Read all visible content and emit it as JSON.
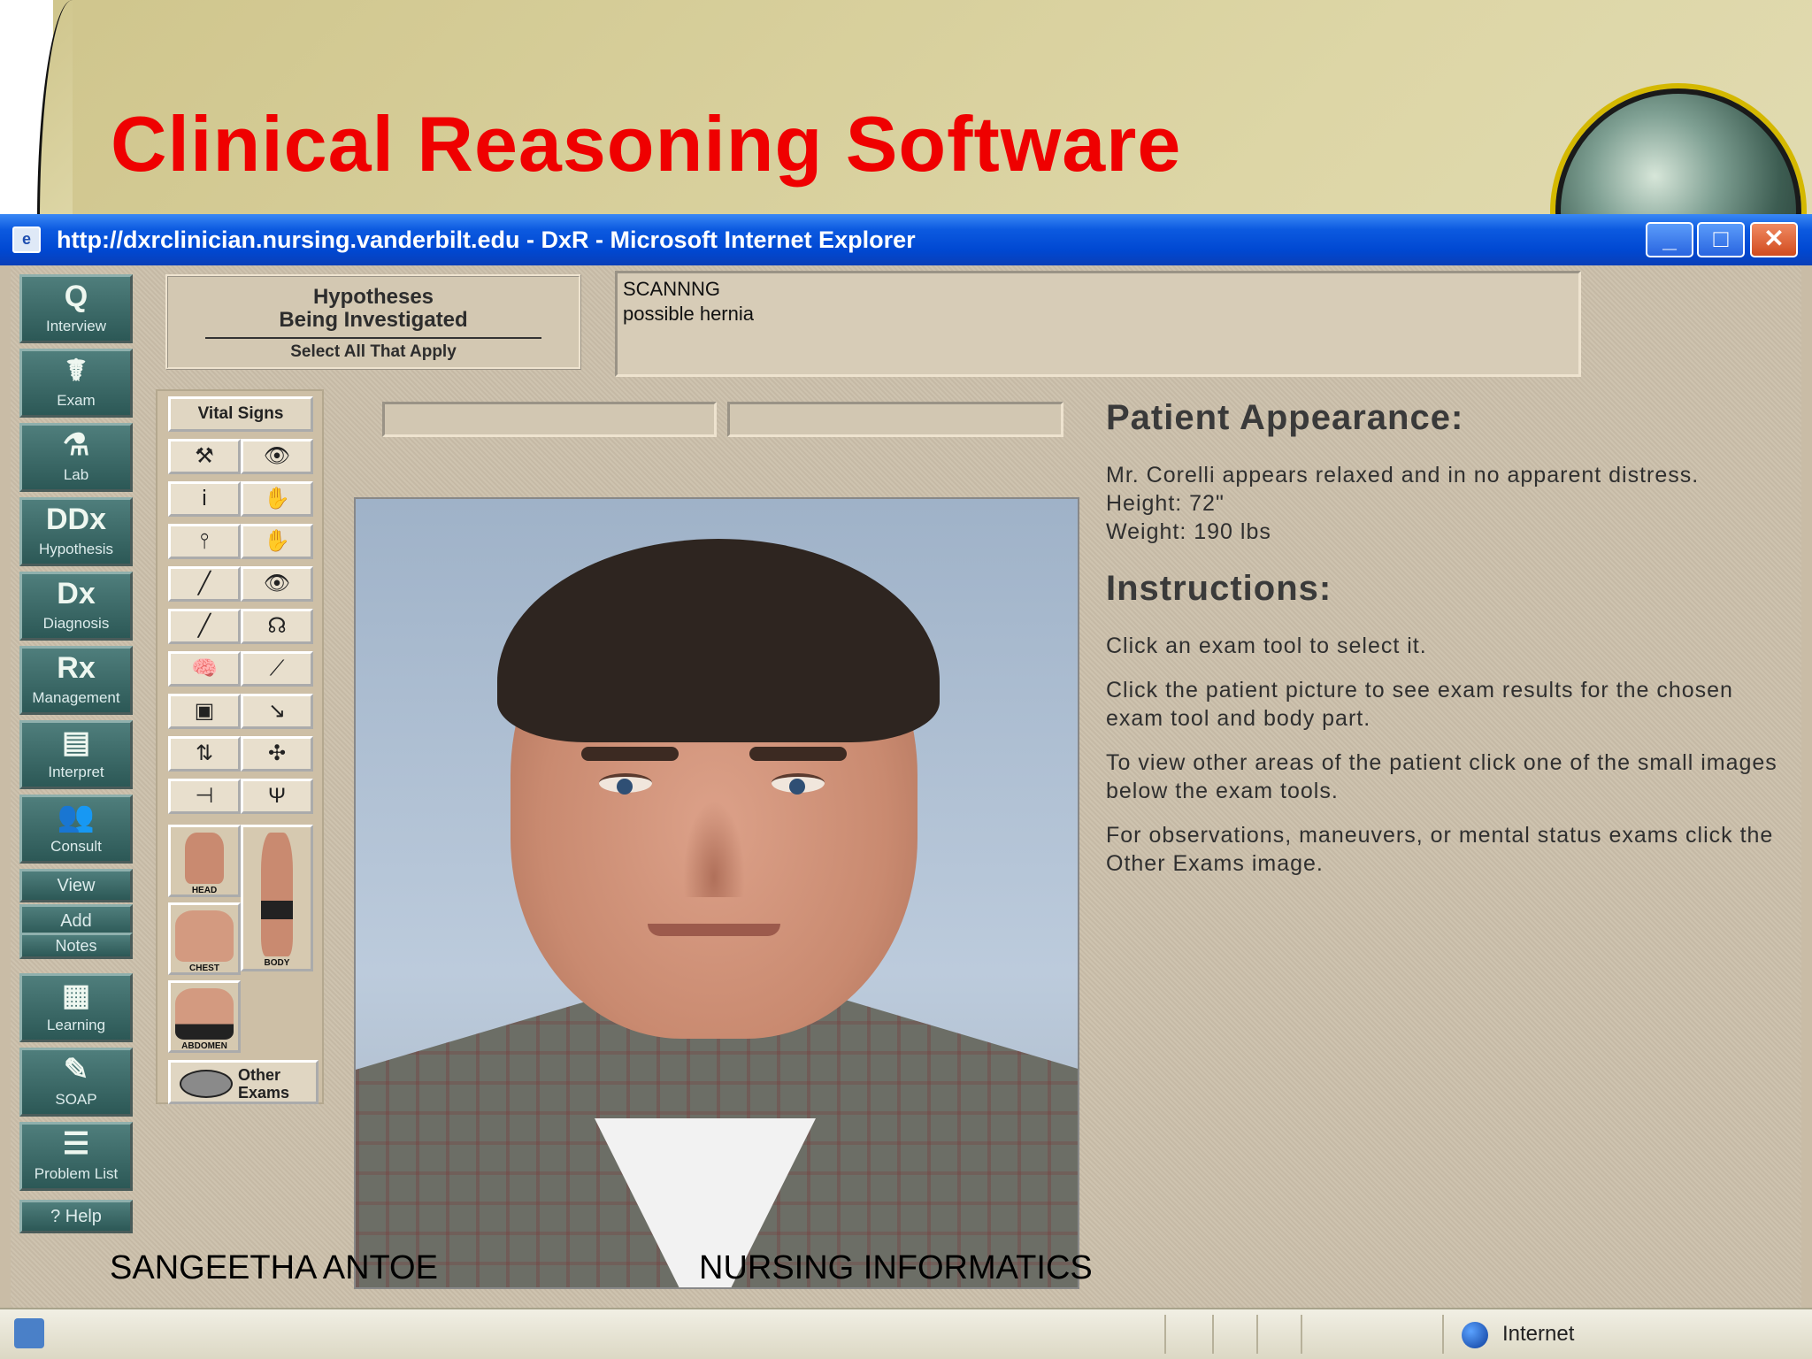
{
  "slide": {
    "title": "Clinical Reasoning Software",
    "author": "SANGEETHA ANTOE",
    "course": "NURSING INFORMATICS"
  },
  "browser": {
    "title": "http://dxrclinician.nursing.vanderbilt.edu - DxR - Microsoft Internet Explorer",
    "minimize": "_",
    "maximize": "□",
    "close": "✕",
    "status_zone": "Internet"
  },
  "nav": {
    "items": [
      {
        "glyph": "Q",
        "label": "Interview"
      },
      {
        "glyph": "☤",
        "label": "Exam"
      },
      {
        "glyph": "⚗",
        "label": "Lab"
      },
      {
        "glyph": "DDx",
        "label": "Hypothesis"
      },
      {
        "glyph": "Dx",
        "label": "Diagnosis"
      },
      {
        "glyph": "Rx",
        "label": "Management"
      },
      {
        "glyph": "▤",
        "label": "Interpret"
      },
      {
        "glyph": "👥",
        "label": "Consult"
      }
    ],
    "view": "View",
    "add": "Add",
    "notes": "Notes",
    "lower_items": [
      {
        "glyph": "▦",
        "label": "Learning"
      },
      {
        "glyph": "✎",
        "label": "SOAP"
      },
      {
        "glyph": "☰",
        "label": "Problem List"
      }
    ],
    "help": "? Help"
  },
  "hypotheses": {
    "title_line1": "Hypotheses",
    "title_line2": "Being Investigated",
    "subtitle": "Select All That Apply"
  },
  "scan": {
    "line1": "SCANNNG",
    "line2": "possible hernia"
  },
  "tools": {
    "vital_signs": "Vital Signs",
    "icons": [
      "reflex-hammer",
      "eye",
      "otoscope",
      "hand-palpation",
      "tuning-fork",
      "hand-percussion",
      "tongue-depressor",
      "eye-exam",
      "thermometer",
      "stethoscope",
      "brain",
      "swab",
      "monitor",
      "probe",
      "arrows",
      "bugs",
      "reflex-tool",
      "fork"
    ],
    "icon_glyphs": [
      "⚒",
      "👁",
      "ⅰ",
      "✋",
      "⫯",
      "✋",
      "╱",
      "👁",
      "╱",
      "☊",
      "🧠",
      "⟋",
      "▣",
      "↘",
      "⇅",
      "✣",
      "⊣",
      "Ψ"
    ],
    "body_parts": [
      {
        "label": "HEAD"
      },
      {
        "label": "BODY"
      },
      {
        "label": "CHEST"
      },
      {
        "label": "ABDOMEN"
      }
    ],
    "other_exams_line1": "Other",
    "other_exams_line2": "Exams"
  },
  "patient": {
    "appearance_heading": "Patient Appearance:",
    "appearance_text": "Mr. Corelli appears relaxed and in no apparent distress.",
    "height": "Height: 72\"",
    "weight": "Weight: 190 lbs",
    "instructions_heading": "Instructions:",
    "instr1": "Click an exam tool to select it.",
    "instr2": "Click the patient picture to see exam results for the chosen exam tool and body part.",
    "instr3": "To view other areas of the patient click one of the small images below the exam tools.",
    "instr4": "For observations, maneuvers, or mental status exams click the Other Exams image."
  },
  "colors": {
    "title_red": "#ef0000",
    "ie_blue": "#0048d2",
    "nav_teal": "#2c5856",
    "panel_beige": "#cbbfaa"
  }
}
